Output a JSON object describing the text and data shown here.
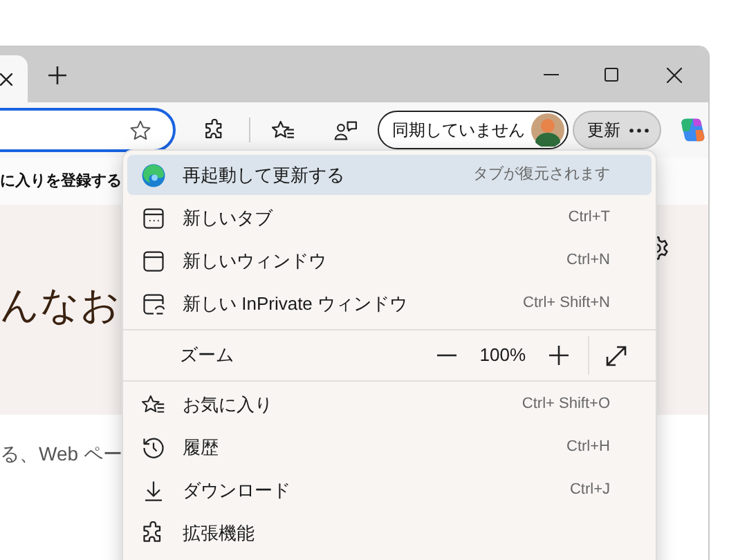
{
  "toolbar": {
    "sync_button": {
      "label": "同期していません"
    },
    "update_button": {
      "label": "更新"
    }
  },
  "page": {
    "favorites_hint": "に入りを登録する",
    "heading": "んなお",
    "search_hint": "る、Web ペー"
  },
  "menu": {
    "sections": [
      [
        {
          "kind": "command",
          "label": "再起動して更新する",
          "hint": "タブが復元されます",
          "selected": true
        },
        {
          "kind": "command",
          "label": "新しいタブ",
          "hint": "Ctrl+T",
          "selected": false
        },
        {
          "kind": "command",
          "label": "新しいウィンドウ",
          "hint": "Ctrl+N",
          "selected": false
        },
        {
          "kind": "command",
          "label": "新しい InPrivate ウィンドウ",
          "hint": "Ctrl+ Shift+N",
          "selected": false
        }
      ],
      [
        {
          "kind": "zoom",
          "label": "ズーム",
          "value": "100%",
          "selected": false
        }
      ],
      [
        {
          "kind": "command",
          "label": "お気に入り",
          "hint": "Ctrl+ Shift+O",
          "selected": false
        },
        {
          "kind": "command",
          "label": "履歴",
          "hint": "Ctrl+H",
          "selected": false
        },
        {
          "kind": "command",
          "label": "ダウンロード",
          "hint": "Ctrl+J",
          "selected": false
        },
        {
          "kind": "command",
          "label": "拡張機能",
          "selected": false
        }
      ]
    ]
  }
}
